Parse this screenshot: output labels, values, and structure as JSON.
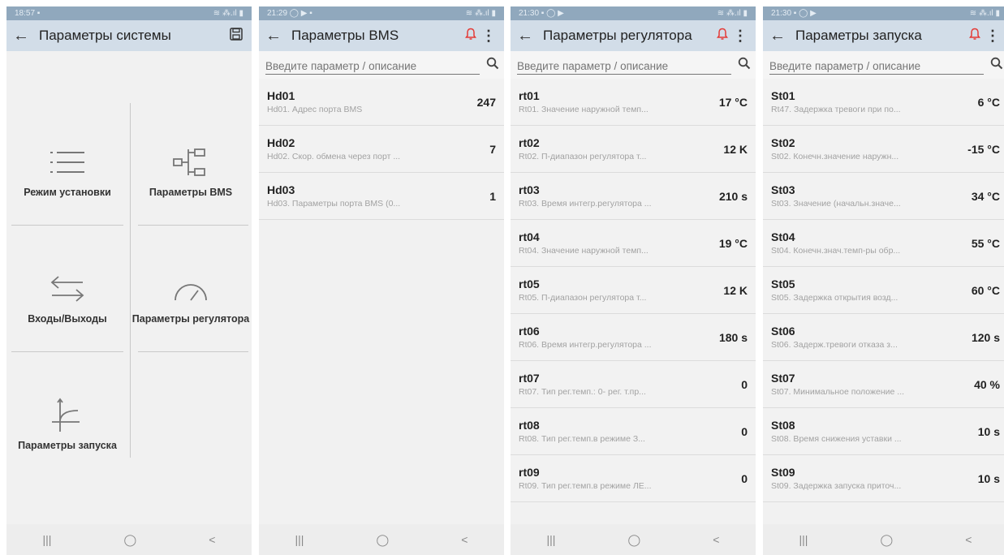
{
  "screens": [
    {
      "status_time": "18:57 ▪",
      "status_icons": "≋ ⁂.ıl ▮",
      "title": "Параметры системы",
      "tiles": [
        {
          "label": "Режим установки",
          "icon": "list-icon"
        },
        {
          "label": "Параметры BMS",
          "icon": "tree-icon"
        },
        {
          "label": "Входы/Выходы",
          "icon": "arrows-icon"
        },
        {
          "label": "Параметры регулятора",
          "icon": "gauge-icon"
        },
        {
          "label": "Параметры запуска",
          "icon": "curve-icon"
        }
      ]
    },
    {
      "status_time": "21:29 ◯ ▶ ▪",
      "status_icons": "≋ ⁂.ıl ▮",
      "title": "Параметры BMS",
      "search_placeholder": "Введите параметр / описание",
      "rows": [
        {
          "code": "Hd01",
          "desc": "Hd01. Адрес порта BMS",
          "value": "247"
        },
        {
          "code": "Hd02",
          "desc": "Hd02. Скор. обмена через порт ...",
          "value": "7"
        },
        {
          "code": "Hd03",
          "desc": "Hd03. Параметры порта BMS (0...",
          "value": "1"
        }
      ]
    },
    {
      "status_time": "21:30 ▪ ◯ ▶",
      "status_icons": "≋ ⁂.ıl ▮",
      "title": "Параметры регулятора",
      "search_placeholder": "Введите параметр / описание",
      "rows": [
        {
          "code": "rt01",
          "desc": "Rt01. Значение наружной темп...",
          "value": "17 °C"
        },
        {
          "code": "rt02",
          "desc": "Rt02. П-диапазон регулятора т...",
          "value": "12 K"
        },
        {
          "code": "rt03",
          "desc": "Rt03. Время интегр.регулятора ...",
          "value": "210 s"
        },
        {
          "code": "rt04",
          "desc": "Rt04. Значение наружной темп...",
          "value": "19 °C"
        },
        {
          "code": "rt05",
          "desc": "Rt05. П-диапазон регулятора т...",
          "value": "12 K"
        },
        {
          "code": "rt06",
          "desc": "Rt06. Время интегр.регулятора ...",
          "value": "180 s"
        },
        {
          "code": "rt07",
          "desc": "Rt07. Тип рег.темп.: 0- рег. т.пр...",
          "value": "0"
        },
        {
          "code": "rt08",
          "desc": "Rt08. Тип рег.темп.в режиме З...",
          "value": "0"
        },
        {
          "code": "rt09",
          "desc": "Rt09. Тип рег.темп.в режиме ЛЕ...",
          "value": "0"
        }
      ]
    },
    {
      "status_time": "21:30 ▪ ◯ ▶",
      "status_icons": "≋ ⁂.ıl ▮",
      "title": "Параметры запуска",
      "search_placeholder": "Введите параметр / описание",
      "rows": [
        {
          "code": "St01",
          "desc": "Rt47. Задержка тревоги при по...",
          "value": "6 °C"
        },
        {
          "code": "St02",
          "desc": "St02. Конечн.значение наружн...",
          "value": "-15 °C"
        },
        {
          "code": "St03",
          "desc": "St03. Значение (начальн.значе...",
          "value": "34 °C"
        },
        {
          "code": "St04",
          "desc": "St04. Конечн.знач.темп-ры обр...",
          "value": "55 °C"
        },
        {
          "code": "St05",
          "desc": "St05. Задержка открытия возд...",
          "value": "60 °C"
        },
        {
          "code": "St06",
          "desc": "St06. Задерж.тревоги отказа з...",
          "value": "120 s"
        },
        {
          "code": "St07",
          "desc": "St07. Минимальное положение ...",
          "value": "40 %"
        },
        {
          "code": "St08",
          "desc": "St08. Время снижения уставки ...",
          "value": "10 s"
        },
        {
          "code": "St09",
          "desc": "St09. Задержка запуска приточ...",
          "value": "10 s"
        }
      ]
    }
  ],
  "nav": {
    "recent": "|||",
    "home": "◯",
    "back": "<"
  },
  "glyphs": {
    "back_arrow": "←",
    "search": "🔍︎",
    "save": "💾︎",
    "bell": "🔔︎",
    "more": "⋮"
  }
}
